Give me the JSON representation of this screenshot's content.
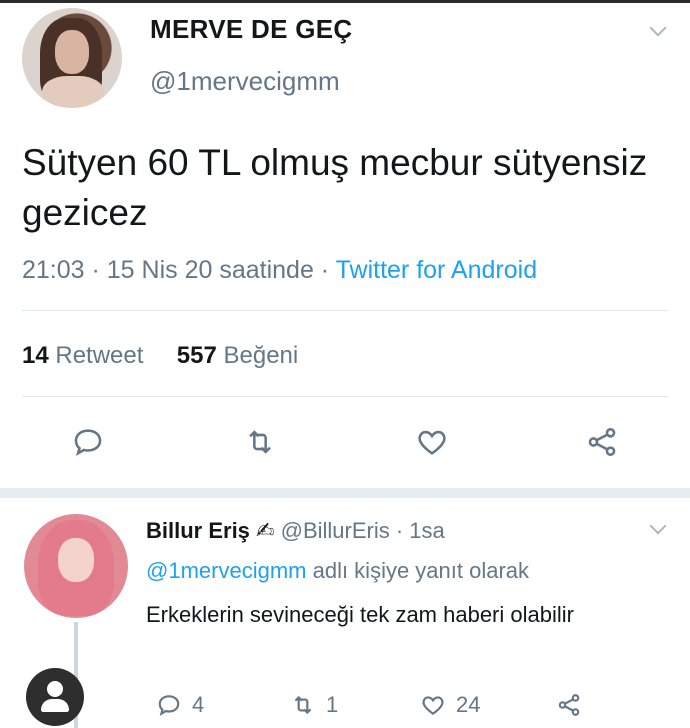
{
  "tweet": {
    "display_name": "MERVE DE GEÇ",
    "handle": "@1mervecigmm",
    "text": "Sütyen 60 TL olmuş mecbur sütyensiz gezicez",
    "time": "21:03 · 15 Nis 20 saatinde",
    "separator": " · ",
    "source": "Twitter for Android",
    "retweet_count": "14",
    "retweet_label": "Retweet",
    "like_count": "557",
    "like_label": "Beğeni"
  },
  "actions": [
    "reply-icon",
    "retweet-icon",
    "like-icon",
    "share-icon"
  ],
  "reply": {
    "display_name": "Billur Eriş",
    "emoji": "✍",
    "handle": "@BillurEris",
    "time": "· 1sa",
    "reply_to_mention": "@1mervecigmm",
    "reply_to_suffix": "adlı kişiye yanıt olarak",
    "text": "Erkeklerin sevineceği tek zam haberi olabilir",
    "reply_count": "4",
    "retweet_count": "1",
    "like_count": "24"
  },
  "colors": {
    "link": "#1da1f2",
    "muted": "#657786",
    "text": "#14171a"
  }
}
